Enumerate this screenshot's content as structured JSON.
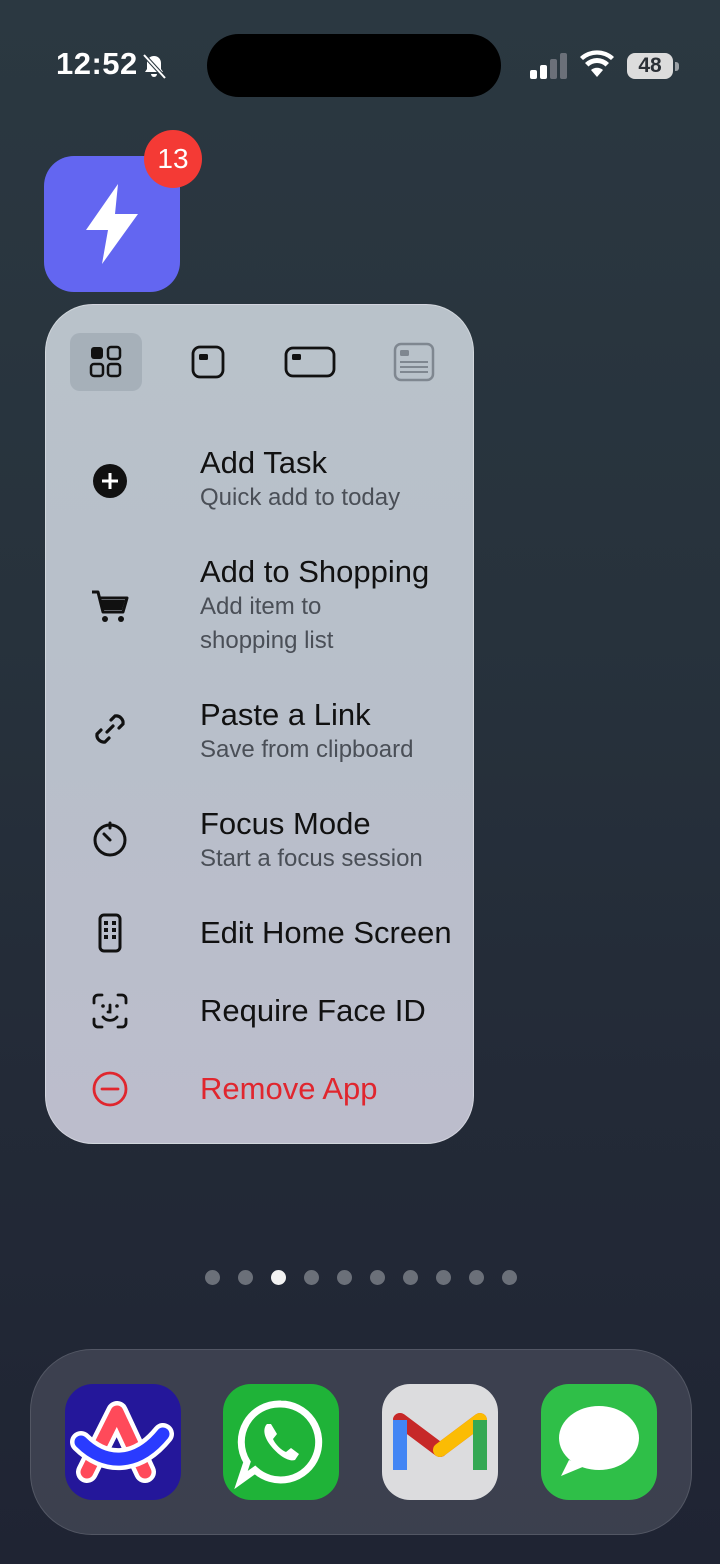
{
  "status_bar": {
    "time": "12:52",
    "battery": "48",
    "icons": [
      "bell-slash-icon",
      "cellular-signal-icon",
      "wifi-icon",
      "battery-icon"
    ]
  },
  "app": {
    "name_icon": "lightning-bolt-icon",
    "badge_count": "13",
    "accent_color": "#6366f1"
  },
  "widget_sizes": [
    {
      "name": "small-grid-size",
      "selected": true
    },
    {
      "name": "small-size",
      "selected": false
    },
    {
      "name": "medium-size",
      "selected": false
    },
    {
      "name": "large-size",
      "selected": false
    }
  ],
  "menu": {
    "items": [
      {
        "title": "Add Task",
        "subtitle": "Quick add to today",
        "icon": "plus-circle-icon"
      },
      {
        "title": "Add to Shopping",
        "subtitle_line1": "Add item to",
        "subtitle_line2": "shopping list",
        "icon": "cart-icon"
      },
      {
        "title": "Paste a Link",
        "subtitle": "Save from clipboard",
        "icon": "link-icon"
      },
      {
        "title": "Focus Mode",
        "subtitle": "Start a focus session",
        "icon": "timer-icon"
      },
      {
        "title": "Edit Home Screen",
        "icon": "phone-apps-icon"
      },
      {
        "title": "Require Face ID",
        "icon": "face-id-icon"
      },
      {
        "title": "Remove App",
        "icon": "minus-circle-icon",
        "destructive": true
      }
    ],
    "destructive_color": "#e0262e"
  },
  "page_dots": {
    "count": 10,
    "active_index": 2
  },
  "dock": {
    "apps": [
      "Arc",
      "WhatsApp",
      "Gmail",
      "Messages"
    ]
  }
}
